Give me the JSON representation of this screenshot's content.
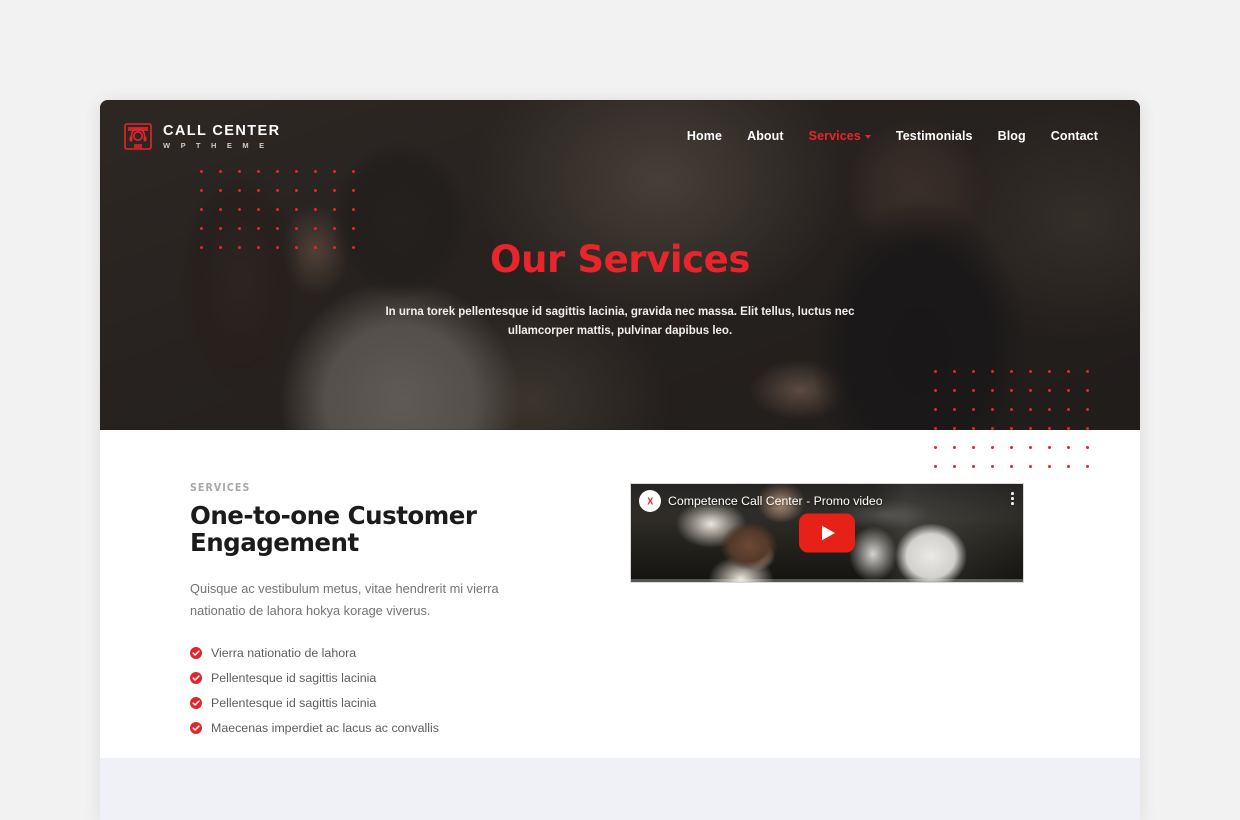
{
  "theme": {
    "accent_red": "#e8252a",
    "page_bg": "#f2f2f2",
    "section_bg": "#ffffff",
    "band_bg": "#eff1f6",
    "muted_text": "#737373",
    "eyebrow_gray": "#a8a8a8"
  },
  "header": {
    "logo_icon": "call-center-headset-icon",
    "brand_title": "CALL CENTER",
    "brand_subtitle": "W P   T H E M E",
    "nav": [
      {
        "label": "Home",
        "active": false,
        "has_dropdown": false
      },
      {
        "label": "About",
        "active": false,
        "has_dropdown": false
      },
      {
        "label": "Services",
        "active": true,
        "has_dropdown": true
      },
      {
        "label": "Testimonials",
        "active": false,
        "has_dropdown": false
      },
      {
        "label": "Blog",
        "active": false,
        "has_dropdown": false
      },
      {
        "label": "Contact",
        "active": false,
        "has_dropdown": false
      }
    ]
  },
  "hero": {
    "title": "Our Services",
    "subtitle": "In urna torek pellentesque id sagittis lacinia, gravida nec massa. Elit tellus, luctus nec ullamcorper mattis, pulvinar dapibus leo.",
    "decor": {
      "left_dots": {
        "cols": 9,
        "rows": 5,
        "spacing": 19
      },
      "right_dots": {
        "cols": 9,
        "rows": 6,
        "spacing": 19
      }
    }
  },
  "services": {
    "eyebrow": "SERVICES",
    "title": "One-to-one Customer Engagement",
    "paragraph": "Quisque ac vestibulum metus, vitae hendrerit mi vierra nationatio de lahora hokya korage viverus.",
    "checklist": [
      {
        "icon": "check-circle-icon",
        "label": "Vierra nationatio de lahora"
      },
      {
        "icon": "check-circle-icon",
        "label": "Pellentesque id sagittis lacinia"
      },
      {
        "icon": "check-circle-icon",
        "label": "Pellentesque id sagittis lacinia"
      },
      {
        "icon": "check-circle-icon",
        "label": "Maecenas imperdiet ac lacus ac convallis"
      }
    ],
    "video": {
      "title": "Competence Call Center - Promo video",
      "avatar_label": "X",
      "play_icon": "youtube-play-icon",
      "menu_icon": "kebab-menu-icon"
    }
  }
}
